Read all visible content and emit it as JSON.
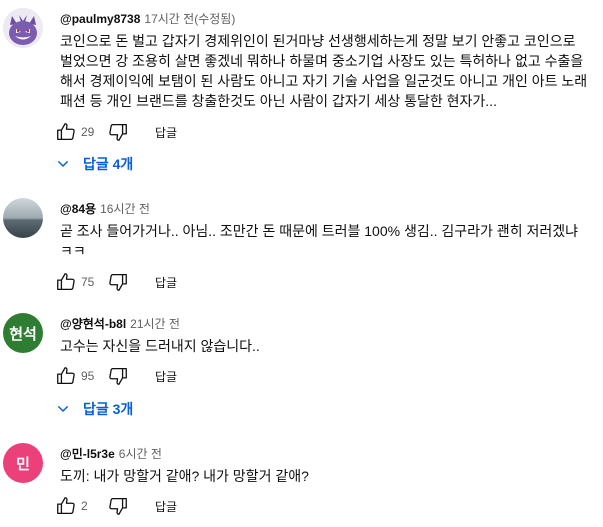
{
  "comments": [
    {
      "handle": "@paulmy8738",
      "time": "17시간 전(수정됨)",
      "text": "코인으로 돈 벌고 갑자기 경제위인이 된거마냥 선생행세하는게 정말 보기 안좋고 코인으로 벌었으면 강 조용히 살면 좋겠네 뭐하나 하물며 중소기업 사장도 있는 특허하나 없고 수출을 해서 경제이익에 보탬이 된 사람도 아니고 자기 기술 사업을 일군것도 아니고 개인 아트 노래 패션 등 개인 브랜드를 창출한것도 아닌 사람이 갑자기 세상 통달한 현자가...",
      "likes": "29",
      "reply_label": "답글",
      "replies_label": "답글 4개"
    },
    {
      "handle": "@84용",
      "time": "16시간 전",
      "text": "곧 조사 들어가거나.. 아님.. 조만간 돈 때문에 트러블 100% 생김..  김구라가 괜히 저러겠냐 ㅋㅋ",
      "likes": "75",
      "reply_label": "답글"
    },
    {
      "avatar_text": "현석",
      "avatar_color": "#2e7d32",
      "handle": "@양현석-b8l",
      "time": "21시간 전",
      "text": "고수는 자신을 드러내지 않습니다..",
      "likes": "95",
      "reply_label": "답글",
      "replies_label": "답글 3개"
    },
    {
      "avatar_text": "민",
      "avatar_color": "#ec407a",
      "handle": "@민-l5r3e",
      "time": "6시간 전",
      "text": "도끼: 내가 망할거 같애? 내가 망할거 같애?",
      "likes": "2",
      "reply_label": "답글"
    }
  ],
  "icons": {
    "like": "thumb-up-icon",
    "dislike": "thumb-down-icon",
    "expand": "chevron-down-icon"
  },
  "colors": {
    "link_blue": "#065fd4",
    "secondary_text": "#606060"
  }
}
